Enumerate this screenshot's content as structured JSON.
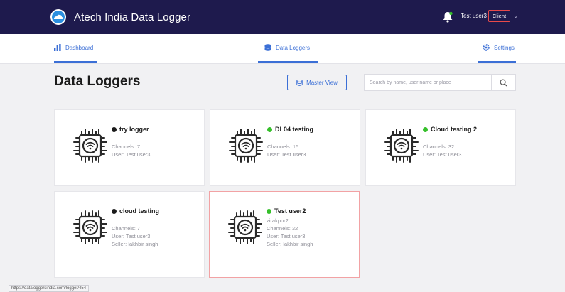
{
  "app": {
    "title": "Atech India Data Logger"
  },
  "user": {
    "name": "Test user3",
    "role": "Client"
  },
  "tabs": [
    {
      "label": "Dashboard"
    },
    {
      "label": "Data Loggers"
    },
    {
      "label": "Settings"
    }
  ],
  "page": {
    "title": "Data Loggers"
  },
  "toolbar": {
    "master_view_label": "Master View",
    "search_placeholder": "Search by name, user name or place"
  },
  "colors": {
    "brand": "#1e1a4d",
    "accent": "#3b6fd6",
    "online": "#36c02b",
    "offline": "#1b1b1b",
    "selected_border": "#f2a2a4"
  },
  "loggers": [
    {
      "name": "try logger",
      "status": "offline",
      "lines": [
        "Channels: 7",
        "User: Test user3"
      ]
    },
    {
      "name": "DL04 testing",
      "status": "online",
      "lines": [
        "Channels: 15",
        "User: Test user3"
      ]
    },
    {
      "name": "Cloud testing 2",
      "status": "online",
      "lines": [
        "Channels: 32",
        "User: Test user3"
      ]
    },
    {
      "name": "cloud testing",
      "status": "offline",
      "lines": [
        "Channels: 7",
        "User: Test user3",
        "Seller: lakhbir singh"
      ]
    },
    {
      "name": "Test user2",
      "status": "online",
      "lines": [
        "zirakpur2",
        "Channels: 32",
        "User: Test user3",
        "Seller: lakhbir singh"
      ]
    }
  ],
  "status_bar": {
    "url": "https://dataloggersindia.com/logger/454"
  }
}
